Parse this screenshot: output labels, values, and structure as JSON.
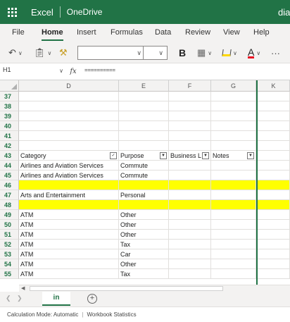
{
  "app": {
    "name": "Excel",
    "location": "OneDrive",
    "doc_name": "dia"
  },
  "menu": [
    "File",
    "Home",
    "Insert",
    "Formulas",
    "Data",
    "Review",
    "View",
    "Help"
  ],
  "menu_active": "Home",
  "ribbon": {
    "font_name_value": "",
    "font_size_value": "",
    "bold_label": "B",
    "font_color_label": "A",
    "more_label": "···"
  },
  "formula_bar": {
    "name_box": "H1",
    "fx_label": "fx",
    "content": "=========="
  },
  "grid": {
    "columns": [
      "D",
      "E",
      "F",
      "G",
      "K"
    ],
    "rows": [
      {
        "num": "37",
        "cells": [
          "",
          "",
          "",
          ""
        ],
        "highlight": false
      },
      {
        "num": "38",
        "cells": [
          "",
          "",
          "",
          ""
        ],
        "highlight": false
      },
      {
        "num": "39",
        "cells": [
          "",
          "",
          "",
          ""
        ],
        "highlight": false
      },
      {
        "num": "40",
        "cells": [
          "",
          "",
          "",
          ""
        ],
        "highlight": false
      },
      {
        "num": "41",
        "cells": [
          "",
          "",
          "",
          ""
        ],
        "highlight": false
      },
      {
        "num": "42",
        "cells": [
          "",
          "",
          "",
          ""
        ],
        "highlight": false
      },
      {
        "num": "43",
        "cells": [
          "Category",
          "Purpose",
          "Business L",
          "Notes"
        ],
        "highlight": false
      },
      {
        "num": "44",
        "cells": [
          "Airlines and Aviation Services",
          "Commute",
          "",
          ""
        ],
        "highlight": false
      },
      {
        "num": "45",
        "cells": [
          "Airlines and Aviation Services",
          "Commute",
          "",
          ""
        ],
        "highlight": false
      },
      {
        "num": "46",
        "cells": [
          "",
          "",
          "",
          ""
        ],
        "highlight": true
      },
      {
        "num": "47",
        "cells": [
          "Arts and Entertainment",
          "Personal",
          "",
          ""
        ],
        "highlight": false
      },
      {
        "num": "48",
        "cells": [
          "",
          "",
          "",
          ""
        ],
        "highlight": true
      },
      {
        "num": "49",
        "cells": [
          "ATM",
          "Other",
          "",
          ""
        ],
        "highlight": false
      },
      {
        "num": "50",
        "cells": [
          "ATM",
          "Other",
          "",
          ""
        ],
        "highlight": false
      },
      {
        "num": "51",
        "cells": [
          "ATM",
          "Other",
          "",
          ""
        ],
        "highlight": false
      },
      {
        "num": "52",
        "cells": [
          "ATM",
          "Tax",
          "",
          ""
        ],
        "highlight": false
      },
      {
        "num": "53",
        "cells": [
          "ATM",
          "Car",
          "",
          ""
        ],
        "highlight": false
      },
      {
        "num": "54",
        "cells": [
          "ATM",
          "Other",
          "",
          ""
        ],
        "highlight": false
      },
      {
        "num": "55",
        "cells": [
          "ATM",
          "Tax",
          "",
          ""
        ],
        "highlight": false
      }
    ],
    "header_row": "43",
    "highlight_color": "#ffff00"
  },
  "sheets": {
    "tabs": [
      "in"
    ],
    "active": "in",
    "add_label": "+"
  },
  "status": {
    "calc_mode": "Calculation Mode: Automatic",
    "workbook_stats": "Workbook Statistics"
  },
  "colors": {
    "brand": "#217346",
    "highlight": "#ffff00",
    "font_color": "#e81123",
    "fill_color": "#ffd800"
  }
}
